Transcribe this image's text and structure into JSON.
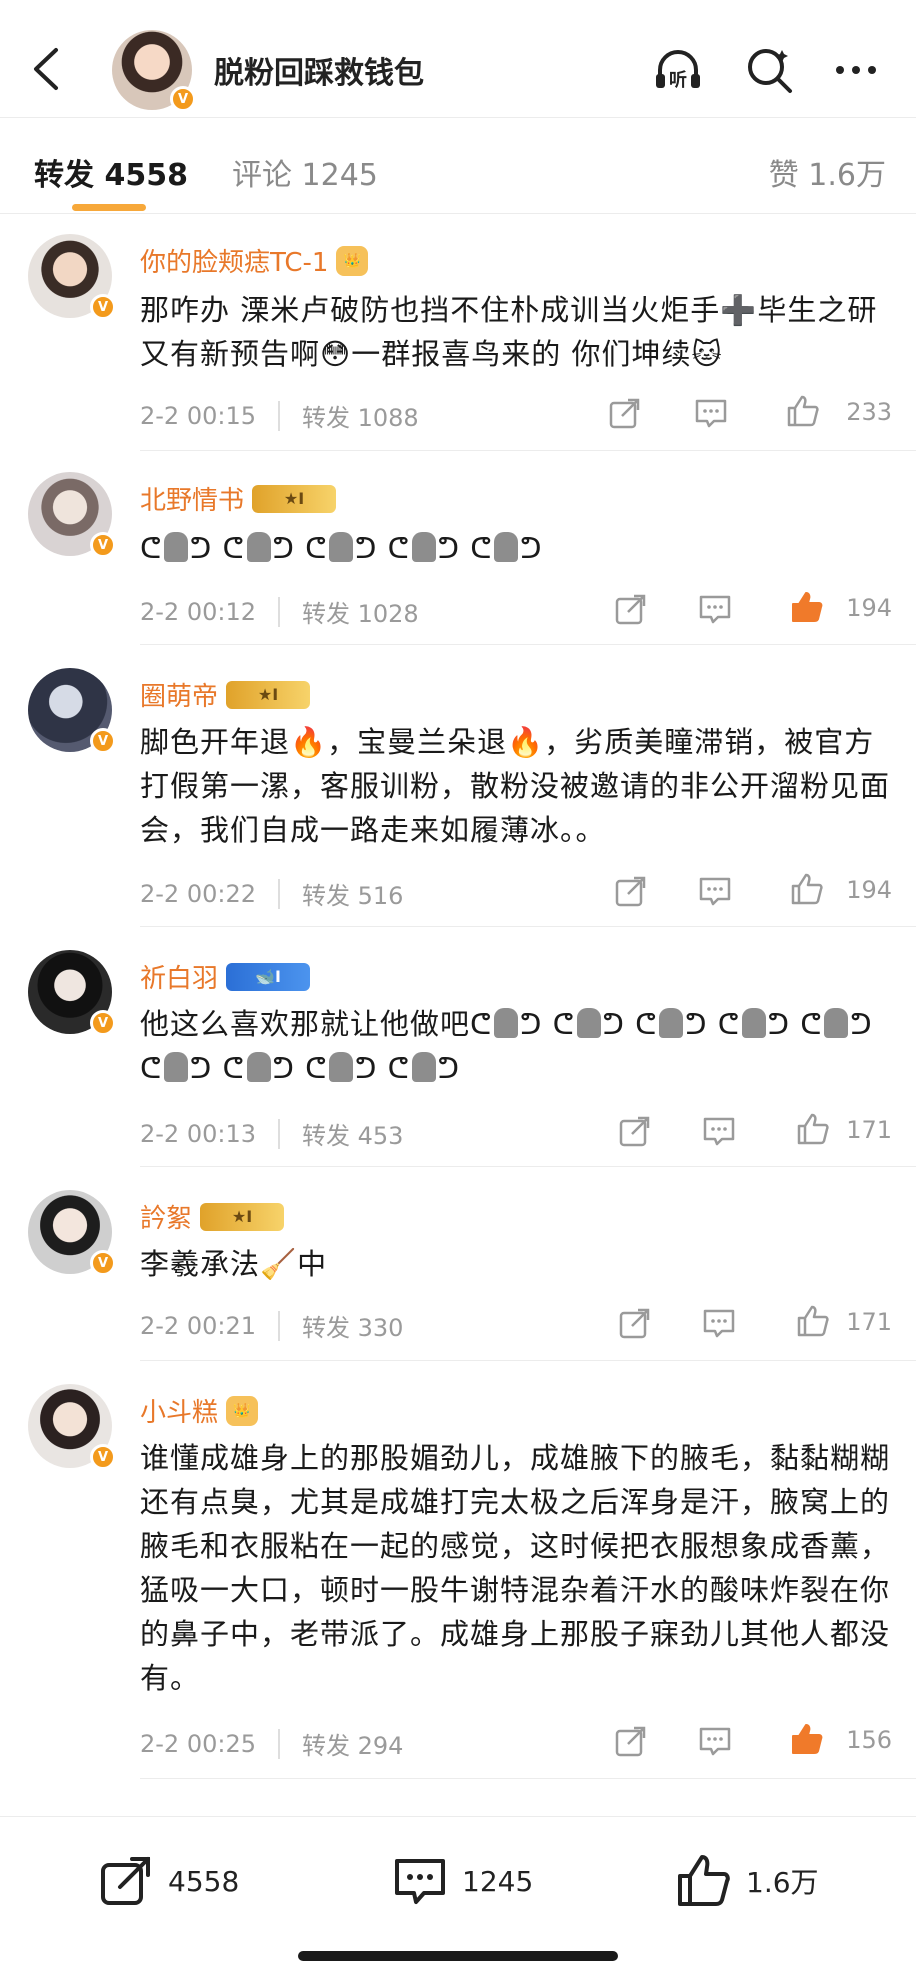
{
  "header": {
    "title": "脱粉回踩救钱包",
    "icons": [
      "back-icon",
      "listen-icon",
      "search-icon",
      "more-icon"
    ],
    "listen_label": "听"
  },
  "tabs": {
    "repost_label": "转发 4558",
    "comment_label": "评论 1245",
    "likes_label": "赞 1.6万",
    "accent": "#f7a83a"
  },
  "comments": [
    {
      "name": "你的脸颊痣TC-1",
      "text": "那咋办 溧米卢破防也挡不住朴成训当火炬手➕毕生之研又有新预告啊😳一群报喜鸟来的 你们坤续🐱",
      "time": "2-2 00:15",
      "repost": "转发 1088",
      "likes": "233",
      "liked": false
    },
    {
      "name": "北野情书",
      "badge": "I",
      "text_prefix": "ᕦ",
      "time": "2-2 00:12",
      "repost": "转发 1028",
      "likes": "194",
      "liked": true
    },
    {
      "name": "圈萌帝",
      "badge": "I",
      "text": "脚色开年退🔥，宝曼兰朵退🔥，劣质美瞳滞销，被官方打假第一漯，客服训粉，散粉没被邀请的非公开溜粉见面会，我们自成一路走来如履薄冰。。",
      "time": "2-2 00:22",
      "repost": "转发 516",
      "likes": "194",
      "liked": false
    },
    {
      "name": "祈白羽",
      "badge": "I",
      "text_prefix": "他这么喜欢那就让他做吧",
      "time": "2-2 00:13",
      "repost": "转发 453",
      "likes": "171",
      "liked": false
    },
    {
      "name": "訡絮",
      "badge": "I",
      "text": "李羲承法🧹中",
      "time": "2-2 00:21",
      "repost": "转发 330",
      "likes": "171",
      "liked": false
    },
    {
      "name": "小斗糕",
      "text": "谁懂成雄身上的那股媚劲儿，成雄腋下的腋毛，黏黏糊糊还有点臭，尤其是成雄打完太极之后浑身是汗，腋窝上的腋毛和衣服粘在一起的感觉，这时候把衣服想象成香薰，猛吸一大口，顿时一股牛谢特混杂着汗水的酸味炸裂在你的鼻子中，老带派了。成雄身上那股子寐劲儿其他人都没有。",
      "time": "2-2 00:25",
      "repost": "转发 294",
      "likes": "156",
      "liked": true
    }
  ],
  "bottom_bar": {
    "repost_count": "4558",
    "comment_count": "1245",
    "like_count": "1.6万"
  },
  "colors": {
    "name": "#e8782a",
    "verified": "#f39a1c",
    "liked": "#f07a2a"
  }
}
